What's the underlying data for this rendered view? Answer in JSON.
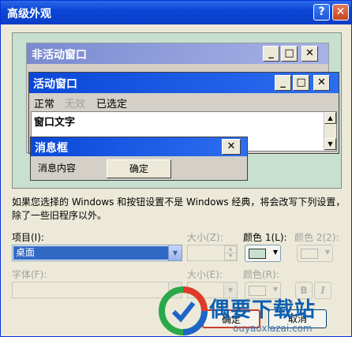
{
  "dialog": {
    "title": "高级外观",
    "help_glyph": "?",
    "close_glyph": "✕"
  },
  "preview": {
    "inactive_title": "非活动窗口",
    "active_title": "活动窗口",
    "menu": {
      "normal": "正常",
      "disabled": "无效",
      "selected": "已选定"
    },
    "window_text": "窗口文字",
    "message_title": "消息框",
    "message_text": "消息内容",
    "ok_label": "确定"
  },
  "note": "如果您选择的 Windows 和按钮设置不是 Windows 经典，将会改写下列设置，除了一些旧程序以外。",
  "controls": {
    "item_label": "项目(I):",
    "item_value": "桌面",
    "size1_label": "大小(Z):",
    "color1_label": "颜色 1(L):",
    "color2_label": "颜色 2(2):",
    "font_label": "字体(F):",
    "size2_label": "大小(E):",
    "color_label": "颜色(R):",
    "bold_glyph": "B",
    "italic_glyph": "I"
  },
  "buttons": {
    "ok": "确定",
    "cancel": "取消"
  },
  "watermark": {
    "name": "偶要下载站",
    "url": "ouyaoxiazai.com"
  },
  "colors": {
    "desktop": "#c7e0d0",
    "selection": "#316ac5",
    "title_active": "#0a48d8"
  }
}
